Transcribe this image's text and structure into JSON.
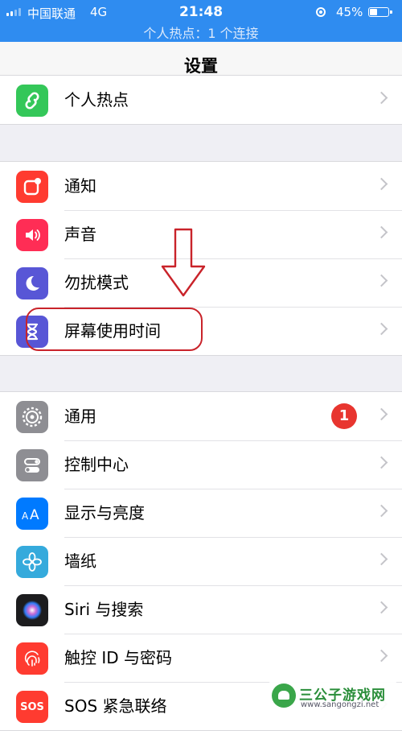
{
  "status_bar": {
    "carrier": "中国联通",
    "network": "4G",
    "time": "21:48",
    "battery_percent": "45%",
    "battery_level": 0.45,
    "signal_bars": 2,
    "hotspot_text": "个人热点：1 个连接",
    "background_color": "#2f8cf0"
  },
  "nav": {
    "title": "设置"
  },
  "groups": [
    {
      "items": [
        {
          "label": "个人热点",
          "icon": "personal-hotspot-icon",
          "icon_color": "#34c759"
        }
      ]
    },
    {
      "items": [
        {
          "label": "通知",
          "icon": "notifications-icon",
          "icon_color": "#ff3b30"
        },
        {
          "label": "声音",
          "icon": "sounds-icon",
          "icon_color": "#ff2d55"
        },
        {
          "label": "勿扰模式",
          "icon": "do-not-disturb-icon",
          "icon_color": "#5856d6"
        },
        {
          "label": "屏幕使用时间",
          "icon": "screen-time-icon",
          "icon_color": "#5856d6"
        }
      ]
    },
    {
      "items": [
        {
          "label": "通用",
          "icon": "general-icon",
          "icon_color": "#8e8e93",
          "badge": "1"
        },
        {
          "label": "控制中心",
          "icon": "control-center-icon",
          "icon_color": "#8e8e93"
        },
        {
          "label": "显示与亮度",
          "icon": "display-brightness-icon",
          "icon_color": "#007aff"
        },
        {
          "label": "墙纸",
          "icon": "wallpaper-icon",
          "icon_color": "#35aadc"
        },
        {
          "label": "Siri 与搜索",
          "icon": "siri-icon",
          "icon_color": "#1c1c1e"
        },
        {
          "label": "触控 ID 与密码",
          "icon": "touch-id-icon",
          "icon_color": "#ff3b30"
        },
        {
          "label": "SOS 紧急联络",
          "icon": "sos-icon",
          "icon_color": "#ff3b30",
          "icon_text": "SOS"
        }
      ]
    }
  ],
  "annotation": {
    "highlight_color": "#c9232a"
  },
  "watermark": {
    "title": "三公子游戏网",
    "url": "www.sangongzi.net"
  }
}
